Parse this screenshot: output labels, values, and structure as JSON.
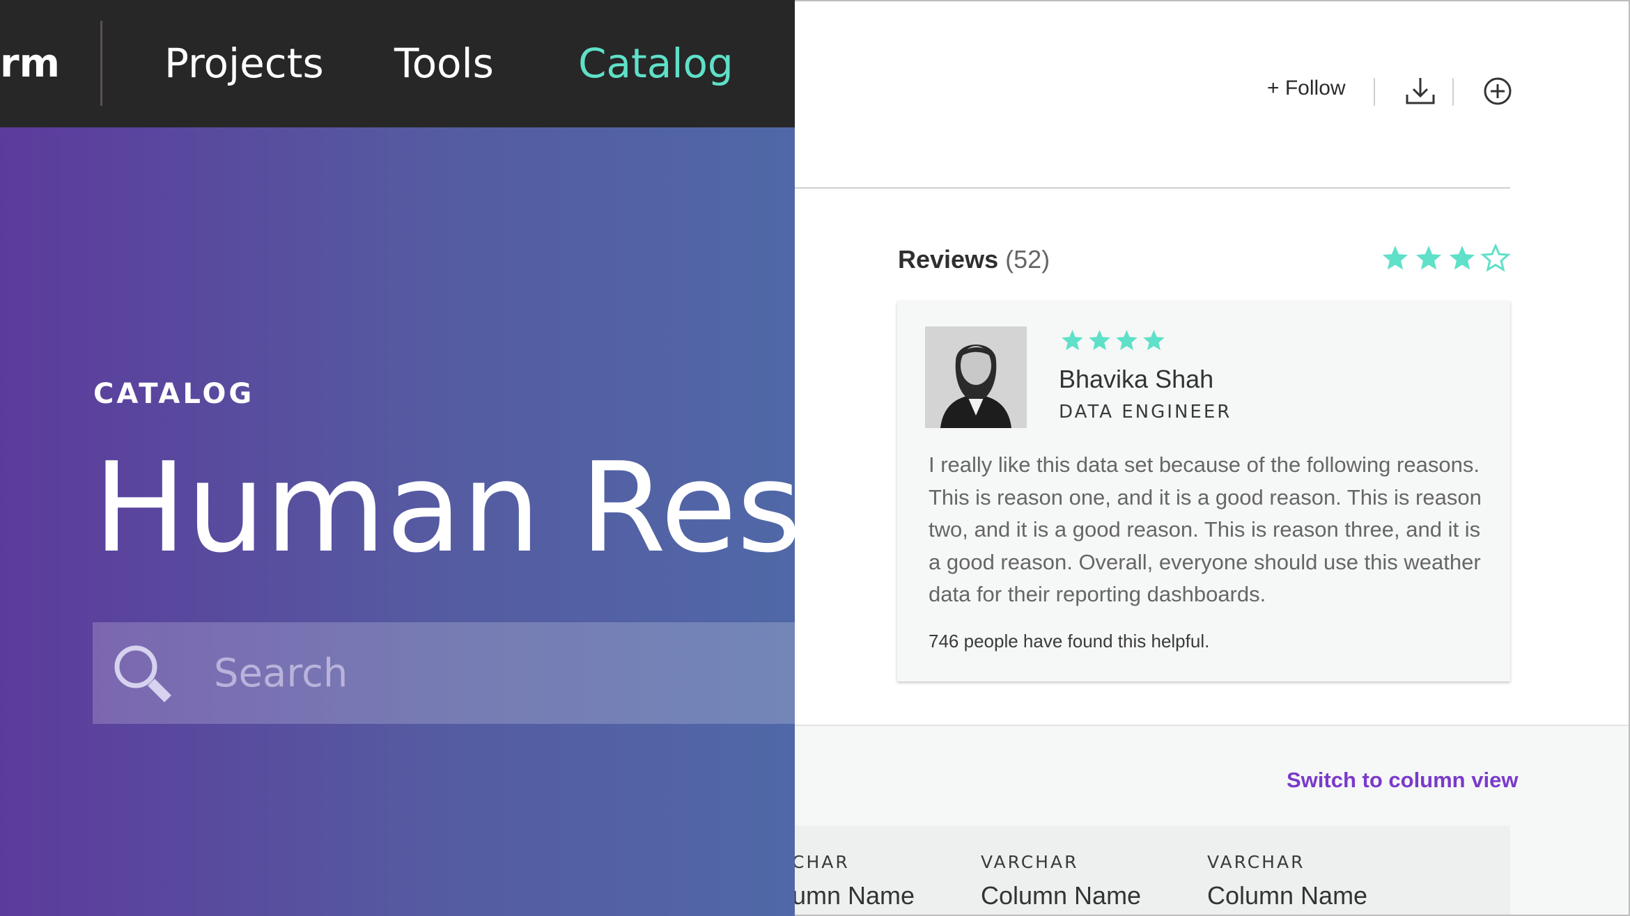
{
  "nav": {
    "brand_fragment": "rm",
    "items": [
      {
        "label": "Projects",
        "active": false
      },
      {
        "label": "Tools",
        "active": false
      },
      {
        "label": "Catalog",
        "active": true
      }
    ]
  },
  "hero": {
    "eyebrow": "CATALOG",
    "title": "Human Resou",
    "search": {
      "placeholder": "Search",
      "value": ""
    }
  },
  "toolbar": {
    "follow_label": "+ Follow",
    "icons": [
      "download-icon",
      "add-circle-icon"
    ]
  },
  "reviews": {
    "heading": "Reviews",
    "count": "(52)",
    "overall_rating": 3,
    "overall_rating_max": 4,
    "review": {
      "rating": 4,
      "reviewer_name": "Bhavika Shah",
      "reviewer_role": "DATA ENGINEER",
      "body": "I really like this data set because of the following reasons. This is reason one, and it is a good reason. This is reason two, and it is a good reason. This is reason three, and it is a good reason. Overall, everyone should use this weather data for their reporting dashboards.",
      "helpful_note": "746 people have found this helpful."
    }
  },
  "columns_section": {
    "switch_label": "Switch to column view",
    "columns": [
      {
        "type": "CHAR",
        "name": "umn Name"
      },
      {
        "type": "VARCHAR",
        "name": "Column Name"
      },
      {
        "type": "VARCHAR",
        "name": "Column Name"
      }
    ]
  },
  "colors": {
    "nav_background": "#272727",
    "nav_active": "#5fe0c8",
    "hero_gradient_start": "#5c3b9c",
    "hero_gradient_end": "#5068a7",
    "star": "#5fe0c8",
    "link": "#7a3aca"
  }
}
